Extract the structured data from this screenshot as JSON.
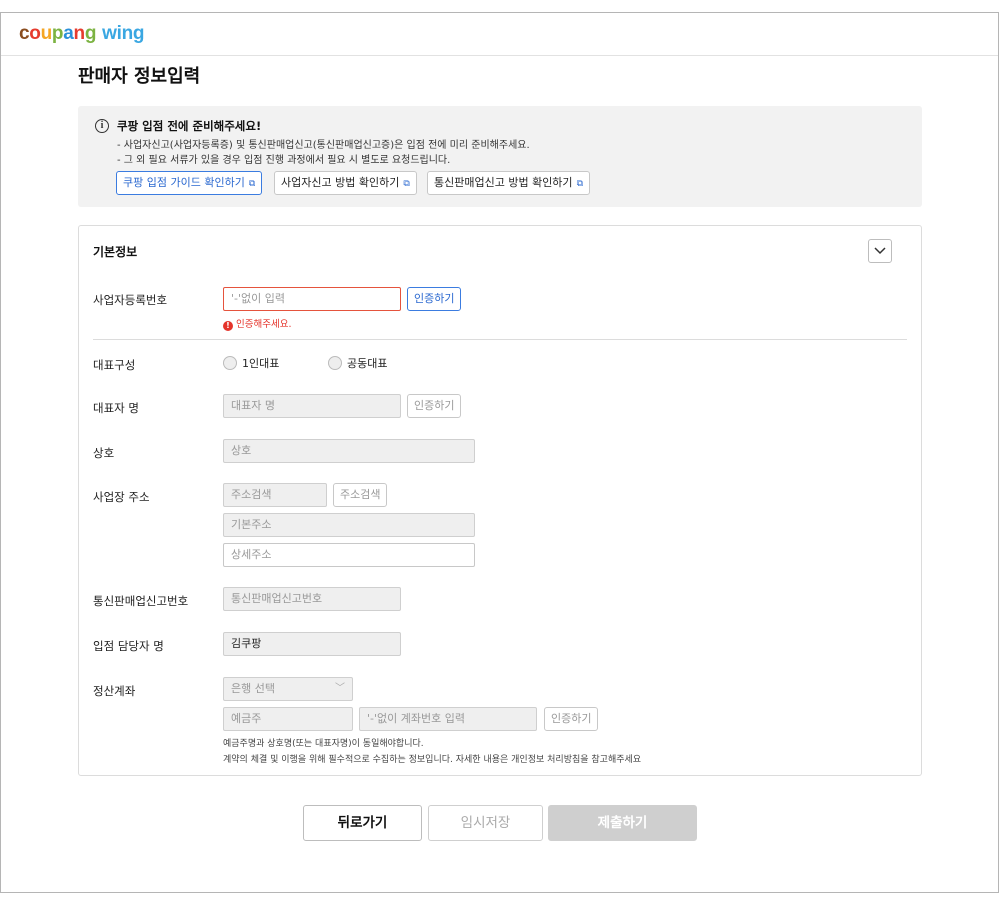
{
  "brand": {
    "logo_letters": [
      "c",
      "o",
      "u",
      "p",
      "a",
      "n",
      "g"
    ],
    "logo_wing": "wing"
  },
  "page": {
    "title": "판매자 정보입력"
  },
  "notice": {
    "title": "쿠팡 입점 전에 준비해주세요!",
    "line1": "- 사업자신고(사업자등록증) 및 통신판매업신고(통신판매업신고증)은 입점 전에 미리 준비해주세요.",
    "line2": "- 그 외 필요 서류가 있을 경우 입점 진행 과정에서 필요 시 별도로 요청드립니다.",
    "buttons": [
      "쿠팡 입점 가이드 확인하기",
      "사업자신고 방법 확인하기",
      "통신판매업신고 방법 확인하기"
    ]
  },
  "basic_info": {
    "title": "기본정보",
    "business_number": {
      "label": "사업자등록번호",
      "placeholder": "'-'없이 입력",
      "verify": "인증하기",
      "error": "인증해주세요."
    },
    "rep_type": {
      "label": "대표구성",
      "options": [
        "1인대표",
        "공동대표"
      ]
    },
    "rep_name": {
      "label": "대표자 명",
      "placeholder": "대표자 명",
      "verify": "인증하기"
    },
    "company": {
      "label": "상호",
      "placeholder": "상호"
    },
    "address": {
      "label": "사업장 주소",
      "search_placeholder": "주소검색",
      "search_button": "주소검색",
      "basic_placeholder": "기본주소",
      "detail_placeholder": "상세주소"
    },
    "ecommerce_number": {
      "label": "통신판매업신고번호",
      "placeholder": "통신판매업신고번호"
    },
    "manager_name": {
      "label": "입점 담당자 명",
      "value": "김쿠팡"
    },
    "account": {
      "label": "정산계좌",
      "bank_placeholder": "은행 선택",
      "holder_placeholder": "예금주",
      "number_placeholder": "'-'없이 계좌번호 입력",
      "verify": "인증하기",
      "help1": "예금주명과 상호명(또는 대표자명)이 동일해야합니다.",
      "help2": "계약의 체결 및 이행을 위해 필수적으로 수집하는 정보입니다. 자세한 내용은 개인정보 처리방침을 참고해주세요"
    }
  },
  "footer": {
    "back": "뒤로가기",
    "save": "임시저장",
    "submit": "제출하기"
  },
  "colors": {
    "accent_blue": "#2a68d0",
    "error_red": "#e5332a",
    "submit_disabled": "#cfcfcf"
  }
}
